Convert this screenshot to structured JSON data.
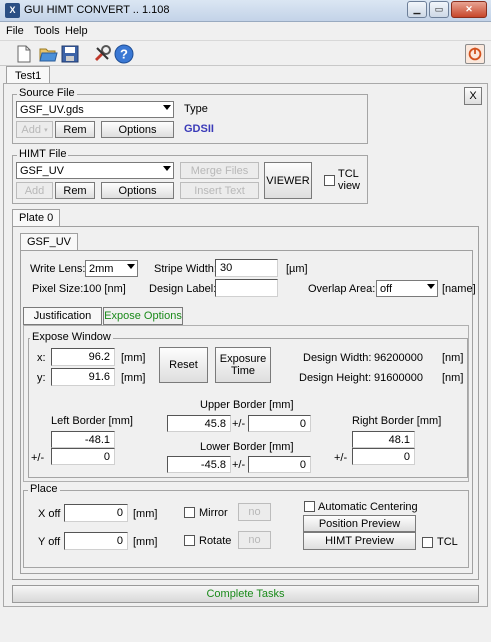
{
  "window": {
    "title": "GUI HIMT CONVERT  .. 1.108",
    "app_icon": "X"
  },
  "menu": {
    "file": "File",
    "tools": "Tools",
    "help": "Help"
  },
  "toolbar": {
    "icons": [
      "new-file-icon",
      "open-folder-icon",
      "save-icon",
      "tools-icon",
      "help-icon",
      "power-icon"
    ]
  },
  "top_tab": "Test1",
  "close_x": "X",
  "source_file": {
    "legend": "Source File",
    "selected": "GSF_UV.gds",
    "type_label": "Type",
    "type_value": "GDSII",
    "add": "Add",
    "rem": "Rem",
    "options": "Options"
  },
  "himt_file": {
    "legend": "HIMT File",
    "selected": "GSF_UV",
    "add": "Add",
    "rem": "Rem",
    "options": "Options",
    "merge": "Merge Files",
    "insert": "Insert Text",
    "viewer": "VIEWER",
    "tcl_view_1": "TCL",
    "tcl_view_2": "view"
  },
  "plate_tab": "Plate 0",
  "gsf_tab": "GSF_UV",
  "write": {
    "lens_label": "Write Lens:",
    "lens_value": "2mm",
    "stripe_label": "Stripe Width:",
    "stripe_value": "30",
    "stripe_unit": "[µm]",
    "pixel_label": "Pixel Size:",
    "pixel_value": "100 [nm]",
    "design_label": "Design Label:",
    "design_value": "",
    "overlap_label": "Overlap Area:",
    "overlap_value": "off",
    "overlap_unit": "[name]"
  },
  "subtabs": {
    "justification": "Justification",
    "expose_options": "Expose Options"
  },
  "expose": {
    "legend": "Expose Window",
    "x_label": "x:",
    "x_value": "96.2",
    "y_label": "y:",
    "y_value": "91.6",
    "unit": "[mm]",
    "reset": "Reset",
    "expose_time_1": "Exposure",
    "expose_time_2": "Time",
    "design_width_label": "Design Width:",
    "design_width_value": "96200000",
    "design_height_label": "Design Height:",
    "design_height_value": "91600000",
    "nm": "[nm]",
    "left_border_label": "Left Border  [mm]",
    "left_value": "-48.1",
    "left_pm": "0",
    "upper_border_label": "Upper Border   [mm]",
    "upper_value": "45.8",
    "upper_pm": "0",
    "lower_border_label": "Lower Border   [mm]",
    "lower_value": "-45.8",
    "lower_pm": "0",
    "right_border_label": "Right Border  [mm]",
    "right_value": "48.1",
    "right_pm": "0",
    "pm": "+/-"
  },
  "place": {
    "legend": "Place",
    "xoff_label": "X off",
    "xoff_value": "0",
    "yoff_label": "Y off",
    "yoff_value": "0",
    "unit": "[mm]",
    "mirror": "Mirror",
    "mirror_btn": "no",
    "rotate": "Rotate",
    "rotate_btn": "no",
    "auto_center": "Automatic Centering",
    "position_preview": "Position Preview",
    "himt_preview": "HIMT Preview",
    "tcl": "TCL"
  },
  "status": "Complete Tasks",
  "colors": {
    "type_blue": "#3a3ab8",
    "status_green": "#1a8a1a",
    "expose_green": "#1a8a1a"
  }
}
